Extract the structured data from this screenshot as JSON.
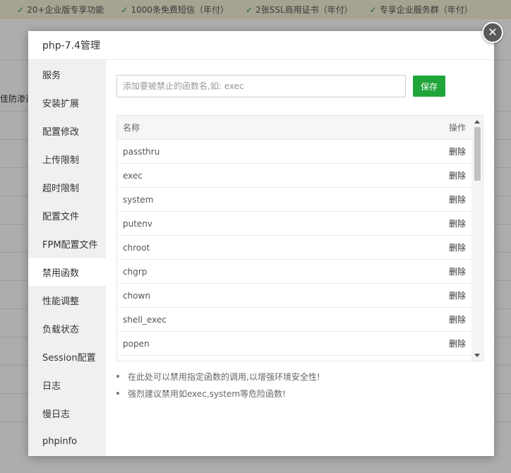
{
  "background": {
    "features": [
      "20+企业版专享功能",
      "1000条免费短信（年付）",
      "2张SSL商用证书（年付）",
      "专享企业服务群（年付）"
    ],
    "side_text": "佳防渗透"
  },
  "modal": {
    "title": "php-7.4管理",
    "close_icon": "close-icon"
  },
  "sidebar": {
    "items": [
      {
        "label": "服务"
      },
      {
        "label": "安装扩展"
      },
      {
        "label": "配置修改"
      },
      {
        "label": "上传限制"
      },
      {
        "label": "超时限制"
      },
      {
        "label": "配置文件"
      },
      {
        "label": "FPM配置文件"
      },
      {
        "label": "禁用函数"
      },
      {
        "label": "性能调整"
      },
      {
        "label": "负载状态"
      },
      {
        "label": "Session配置"
      },
      {
        "label": "日志"
      },
      {
        "label": "慢日志"
      },
      {
        "label": "phpinfo"
      }
    ],
    "active": "禁用函数"
  },
  "form": {
    "placeholder": "添加要被禁止的函数名,如: exec",
    "value": "",
    "save_label": "保存"
  },
  "table": {
    "columns": {
      "name": "名称",
      "action": "操作"
    },
    "rows": [
      {
        "name": "passthru",
        "action": "删除"
      },
      {
        "name": "exec",
        "action": "删除"
      },
      {
        "name": "system",
        "action": "删除"
      },
      {
        "name": "putenv",
        "action": "删除"
      },
      {
        "name": "chroot",
        "action": "删除"
      },
      {
        "name": "chgrp",
        "action": "删除"
      },
      {
        "name": "chown",
        "action": "删除"
      },
      {
        "name": "shell_exec",
        "action": "删除"
      },
      {
        "name": "popen",
        "action": "删除"
      },
      {
        "name": "",
        "action": ""
      }
    ]
  },
  "tips": [
    "在此处可以禁用指定函数的调用,以增强环境安全性!",
    "强烈建议禁用如exec,system等危险函数!"
  ],
  "colors": {
    "accent": "#20a53a",
    "sidebar_bg": "#f0f0f0",
    "close_bg": "#5a5a5a"
  }
}
